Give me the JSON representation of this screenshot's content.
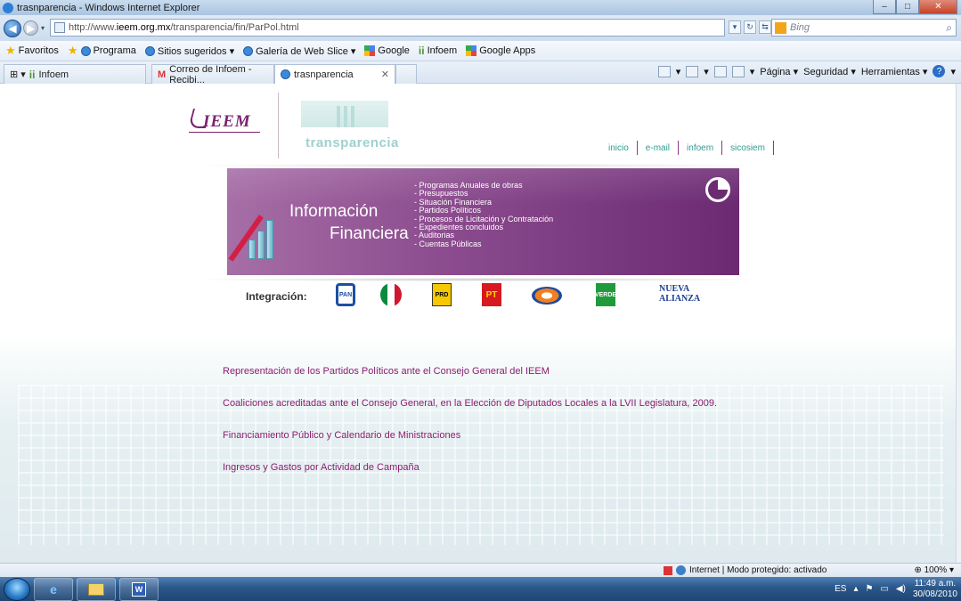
{
  "window": {
    "title": "trasnparencia - Windows Internet Explorer"
  },
  "address_bar": {
    "url_prefix": "http://www.",
    "url_domain": "ieem.org.mx",
    "url_path": "/transparencia/fin/ParPol.html",
    "search_placeholder": "Bing"
  },
  "favorites_bar": {
    "favorites_label": "Favoritos",
    "items": [
      "Programa",
      "Sitios sugeridos ▾",
      "Galería de Web Slice ▾",
      "Google",
      "Infoem",
      "Google Apps"
    ]
  },
  "tabs": [
    "Infoem",
    "Correo de Infoem - Recibi...",
    "trasnparencia"
  ],
  "command_bar": {
    "page": "Página ▾",
    "security": "Seguridad ▾",
    "tools": "Herramientas ▾"
  },
  "site": {
    "logo_text": "IEEM",
    "section_title": "transparencia",
    "nav": [
      "inicio",
      "e-mail",
      "infoem",
      "sicosiem"
    ],
    "banner": {
      "title_line1": "Información",
      "title_line2": "Financiera",
      "items": [
        "- Programas Anuales de obras",
        "- Presupuestos",
        "- Situación Financiera",
        "- Partidos Políticos",
        "- Procesos de Licitación y Contratación",
        "- Expedientes concluidos",
        "- Auditorias",
        "- Cuentas Públicas"
      ]
    },
    "integracion_label": "Integración:",
    "parties": [
      "PAN",
      "PRI",
      "PRD",
      "PT",
      "Convergencia",
      "VERDE",
      "NUEVA ALIANZA"
    ],
    "links": [
      "Representación de los Partidos Políticos ante el Consejo General del IEEM",
      "Coaliciones acreditadas ante el Consejo General, en la Elección de Diputados Locales a la LVII Legislatura, 2009.",
      "Financiamiento Público y Calendario de Ministraciones",
      "Ingresos y Gastos por Actividad de Campaña"
    ]
  },
  "status_bar": {
    "zone": "Internet | Modo protegido: activado",
    "zoom": "100%"
  },
  "taskbar": {
    "lang": "ES",
    "time": "11:49 a.m.",
    "date": "30/08/2010"
  },
  "colors": {
    "accent": "#8b1d6f",
    "teal": "#2f9b92",
    "banner": "#8a4a8d"
  }
}
